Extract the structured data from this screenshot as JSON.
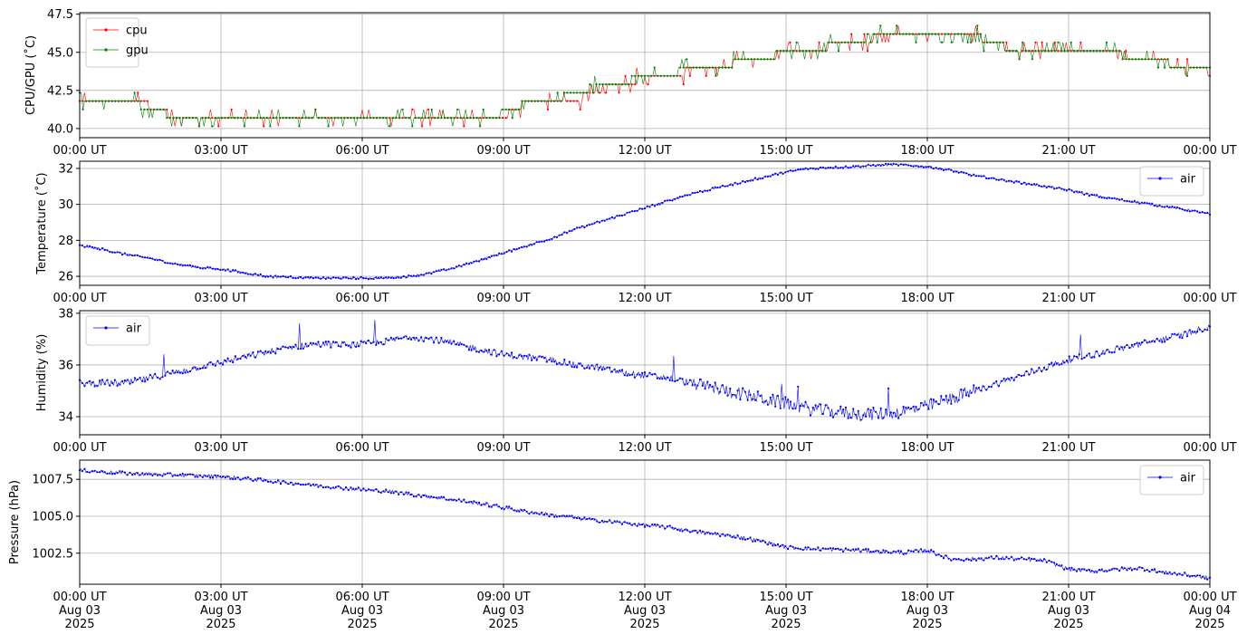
{
  "chart_data": [
    {
      "type": "line",
      "ylabel": "CPU/GPU (˚C)",
      "ylim": [
        39.4,
        47.6
      ],
      "yticks": [
        40.0,
        42.5,
        45.0,
        47.5
      ],
      "ytick_labels": [
        "40.0",
        "42.5",
        "45.0",
        "47.5"
      ],
      "xlim": [
        "2025-08-03T00:00",
        "2025-08-04T00:00"
      ],
      "xtick_labels": [
        "00:00 UT",
        "03:00 UT",
        "06:00 UT",
        "09:00 UT",
        "12:00 UT",
        "15:00 UT",
        "18:00 UT",
        "21:00 UT",
        "00:00 UT"
      ],
      "grid": true,
      "legend_position": "top-left",
      "series": [
        {
          "name": "cpu",
          "color": "#ff0000",
          "x_hours": [
            0,
            0.5,
            1,
            1.5,
            2,
            2.5,
            3,
            3.5,
            4,
            4.5,
            5,
            5.5,
            6,
            6.5,
            7,
            7.5,
            8,
            8.5,
            9,
            9.5,
            10,
            10.5,
            11,
            11.5,
            12,
            12.5,
            13,
            13.5,
            14,
            14.5,
            15,
            15.5,
            16,
            16.5,
            17,
            17.5,
            18,
            18.5,
            19,
            19.5,
            20,
            20.5,
            21,
            21.5,
            22,
            22.5,
            23,
            23.5,
            24
          ],
          "values": [
            41.8,
            41.8,
            41.8,
            41.5,
            40.8,
            40.8,
            40.8,
            40.8,
            40.8,
            40.8,
            40.8,
            40.8,
            40.8,
            40.8,
            40.8,
            40.8,
            40.8,
            40.8,
            40.8,
            41.8,
            41.8,
            41.8,
            42.5,
            42.8,
            43.4,
            43.4,
            43.9,
            43.9,
            44.4,
            44.4,
            45.0,
            45.0,
            45.5,
            45.5,
            46.1,
            46.1,
            46.1,
            46.1,
            46.1,
            45.5,
            45.0,
            45.0,
            45.0,
            45.0,
            45.0,
            44.4,
            44.4,
            43.9,
            43.9
          ]
        },
        {
          "name": "gpu",
          "color": "#008000",
          "x_hours": [
            0,
            0.5,
            1,
            1.5,
            2,
            2.5,
            3,
            3.5,
            4,
            4.5,
            5,
            5.5,
            6,
            6.5,
            7,
            7.5,
            8,
            8.5,
            9,
            9.5,
            10,
            10.5,
            11,
            11.5,
            12,
            12.5,
            13,
            13.5,
            14,
            14.5,
            15,
            15.5,
            16,
            16.5,
            17,
            17.5,
            18,
            18.5,
            19,
            19.5,
            20,
            20.5,
            21,
            21.5,
            22,
            22.5,
            23,
            23.5,
            24
          ],
          "values": [
            42.1,
            41.8,
            41.8,
            41.3,
            40.8,
            40.8,
            40.8,
            40.8,
            40.8,
            40.8,
            40.8,
            40.8,
            40.8,
            40.8,
            40.8,
            40.8,
            40.8,
            40.8,
            41.0,
            41.8,
            41.8,
            42.3,
            42.8,
            43.0,
            43.4,
            43.6,
            43.9,
            43.9,
            44.4,
            44.6,
            45.0,
            45.2,
            45.5,
            45.8,
            46.1,
            46.1,
            46.1,
            46.1,
            46.1,
            45.5,
            45.0,
            45.0,
            45.0,
            45.0,
            45.0,
            44.4,
            44.4,
            43.9,
            43.9
          ]
        }
      ]
    },
    {
      "type": "line",
      "ylabel": "Temperature (˚C)",
      "ylim": [
        25.5,
        32.4
      ],
      "yticks": [
        26,
        28,
        30,
        32
      ],
      "ytick_labels": [
        "26",
        "28",
        "30",
        "32"
      ],
      "xlim": [
        "2025-08-03T00:00",
        "2025-08-04T00:00"
      ],
      "xtick_labels": [
        "00:00 UT",
        "03:00 UT",
        "06:00 UT",
        "09:00 UT",
        "12:00 UT",
        "15:00 UT",
        "18:00 UT",
        "21:00 UT",
        "00:00 UT"
      ],
      "grid": true,
      "legend_position": "top-right",
      "series": [
        {
          "name": "air",
          "color": "#0000ff",
          "x_hours": [
            0,
            0.5,
            1,
            1.5,
            2,
            2.5,
            3,
            3.5,
            4,
            4.5,
            5,
            5.5,
            6,
            6.5,
            7,
            7.5,
            8,
            8.5,
            9,
            9.5,
            10,
            10.5,
            11,
            11.5,
            12,
            12.5,
            13,
            13.5,
            14,
            14.5,
            15,
            15.5,
            16,
            16.5,
            17,
            17.5,
            18,
            18.5,
            19,
            19.5,
            20,
            20.5,
            21,
            21.5,
            22,
            22.5,
            23,
            23.5,
            24
          ],
          "values": [
            27.7,
            27.5,
            27.2,
            27.0,
            26.7,
            26.5,
            26.4,
            26.2,
            26.0,
            25.95,
            25.9,
            25.9,
            25.9,
            25.9,
            26.0,
            26.2,
            26.5,
            26.9,
            27.3,
            27.7,
            28.1,
            28.6,
            29.0,
            29.4,
            29.8,
            30.2,
            30.6,
            30.9,
            31.2,
            31.5,
            31.8,
            32.0,
            32.05,
            32.1,
            32.2,
            32.2,
            32.1,
            31.9,
            31.6,
            31.4,
            31.2,
            31.0,
            30.8,
            30.5,
            30.3,
            30.1,
            29.9,
            29.7,
            29.45
          ]
        }
      ]
    },
    {
      "type": "line",
      "ylabel": "Humidity (%)",
      "ylim": [
        33.3,
        38.1
      ],
      "yticks": [
        34,
        36,
        38
      ],
      "ytick_labels": [
        "34",
        "36",
        "38"
      ],
      "xlim": [
        "2025-08-03T00:00",
        "2025-08-04T00:00"
      ],
      "xtick_labels": [
        "00:00 UT",
        "03:00 UT",
        "06:00 UT",
        "09:00 UT",
        "12:00 UT",
        "15:00 UT",
        "18:00 UT",
        "21:00 UT",
        "00:00 UT"
      ],
      "grid": true,
      "legend_position": "top-left",
      "series": [
        {
          "name": "air",
          "color": "#0000ff",
          "x_hours": [
            0,
            0.5,
            1,
            1.5,
            2,
            2.5,
            3,
            3.5,
            4,
            4.5,
            5,
            5.5,
            6,
            6.5,
            7,
            7.5,
            8,
            8.5,
            9,
            9.5,
            10,
            10.5,
            11,
            11.5,
            12,
            12.5,
            13,
            13.5,
            14,
            14.5,
            15,
            15.5,
            16,
            16.5,
            17,
            17.5,
            18,
            18.5,
            19,
            19.5,
            20,
            20.5,
            21,
            21.5,
            22,
            22.5,
            23,
            23.5,
            24
          ],
          "values": [
            35.3,
            35.3,
            35.3,
            35.5,
            35.7,
            35.9,
            36.1,
            36.3,
            36.5,
            36.7,
            36.8,
            36.8,
            36.8,
            36.9,
            37.1,
            37.0,
            36.8,
            36.6,
            36.4,
            36.3,
            36.2,
            36.0,
            35.9,
            35.7,
            35.6,
            35.5,
            35.3,
            35.1,
            34.9,
            34.7,
            34.5,
            34.3,
            34.2,
            34.1,
            34.1,
            34.2,
            34.4,
            34.7,
            35.0,
            35.3,
            35.6,
            35.9,
            36.2,
            36.4,
            36.6,
            36.8,
            37.0,
            37.2,
            37.5
          ]
        }
      ]
    },
    {
      "type": "line",
      "ylabel": "Pressure (hPa)",
      "ylim": [
        1000.4,
        1008.8
      ],
      "yticks": [
        1002.5,
        1005.0,
        1007.5
      ],
      "ytick_labels": [
        "1002.5",
        "1005.0",
        "1007.5"
      ],
      "xlim": [
        "2025-08-03T00:00",
        "2025-08-04T00:00"
      ],
      "xtick_labels": [
        "00:00 UT\nAug 03\n2025",
        "03:00 UT\nAug 03\n2025",
        "06:00 UT\nAug 03\n2025",
        "09:00 UT\nAug 03\n2025",
        "12:00 UT\nAug 03\n2025",
        "15:00 UT\nAug 03\n2025",
        "18:00 UT\nAug 03\n2025",
        "21:00 UT\nAug 03\n2025",
        "00:00 UT\nAug 04\n2025"
      ],
      "grid": true,
      "legend_position": "top-right",
      "series": [
        {
          "name": "air",
          "color": "#0000ff",
          "x_hours": [
            0,
            0.5,
            1,
            1.5,
            2,
            2.5,
            3,
            3.5,
            4,
            4.5,
            5,
            5.5,
            6,
            6.5,
            7,
            7.5,
            8,
            8.5,
            9,
            9.5,
            10,
            10.5,
            11,
            11.5,
            12,
            12.5,
            13,
            13.5,
            14,
            14.5,
            15,
            15.5,
            16,
            16.5,
            17,
            17.5,
            18,
            18.5,
            19,
            19.5,
            20,
            20.5,
            21,
            21.5,
            22,
            22.5,
            23,
            23.5,
            24
          ],
          "values": [
            1008.1,
            1008.0,
            1007.9,
            1007.85,
            1007.8,
            1007.75,
            1007.7,
            1007.55,
            1007.4,
            1007.25,
            1007.1,
            1006.95,
            1006.8,
            1006.7,
            1006.5,
            1006.3,
            1006.1,
            1005.85,
            1005.6,
            1005.3,
            1005.1,
            1004.9,
            1004.7,
            1004.55,
            1004.4,
            1004.25,
            1004.0,
            1003.8,
            1003.6,
            1003.3,
            1002.9,
            1002.8,
            1002.75,
            1002.7,
            1002.6,
            1002.55,
            1002.7,
            1002.1,
            1002.1,
            1002.2,
            1002.1,
            1002.0,
            1001.4,
            1001.3,
            1001.4,
            1001.5,
            1001.2,
            1001.05,
            1000.8
          ]
        }
      ]
    }
  ]
}
